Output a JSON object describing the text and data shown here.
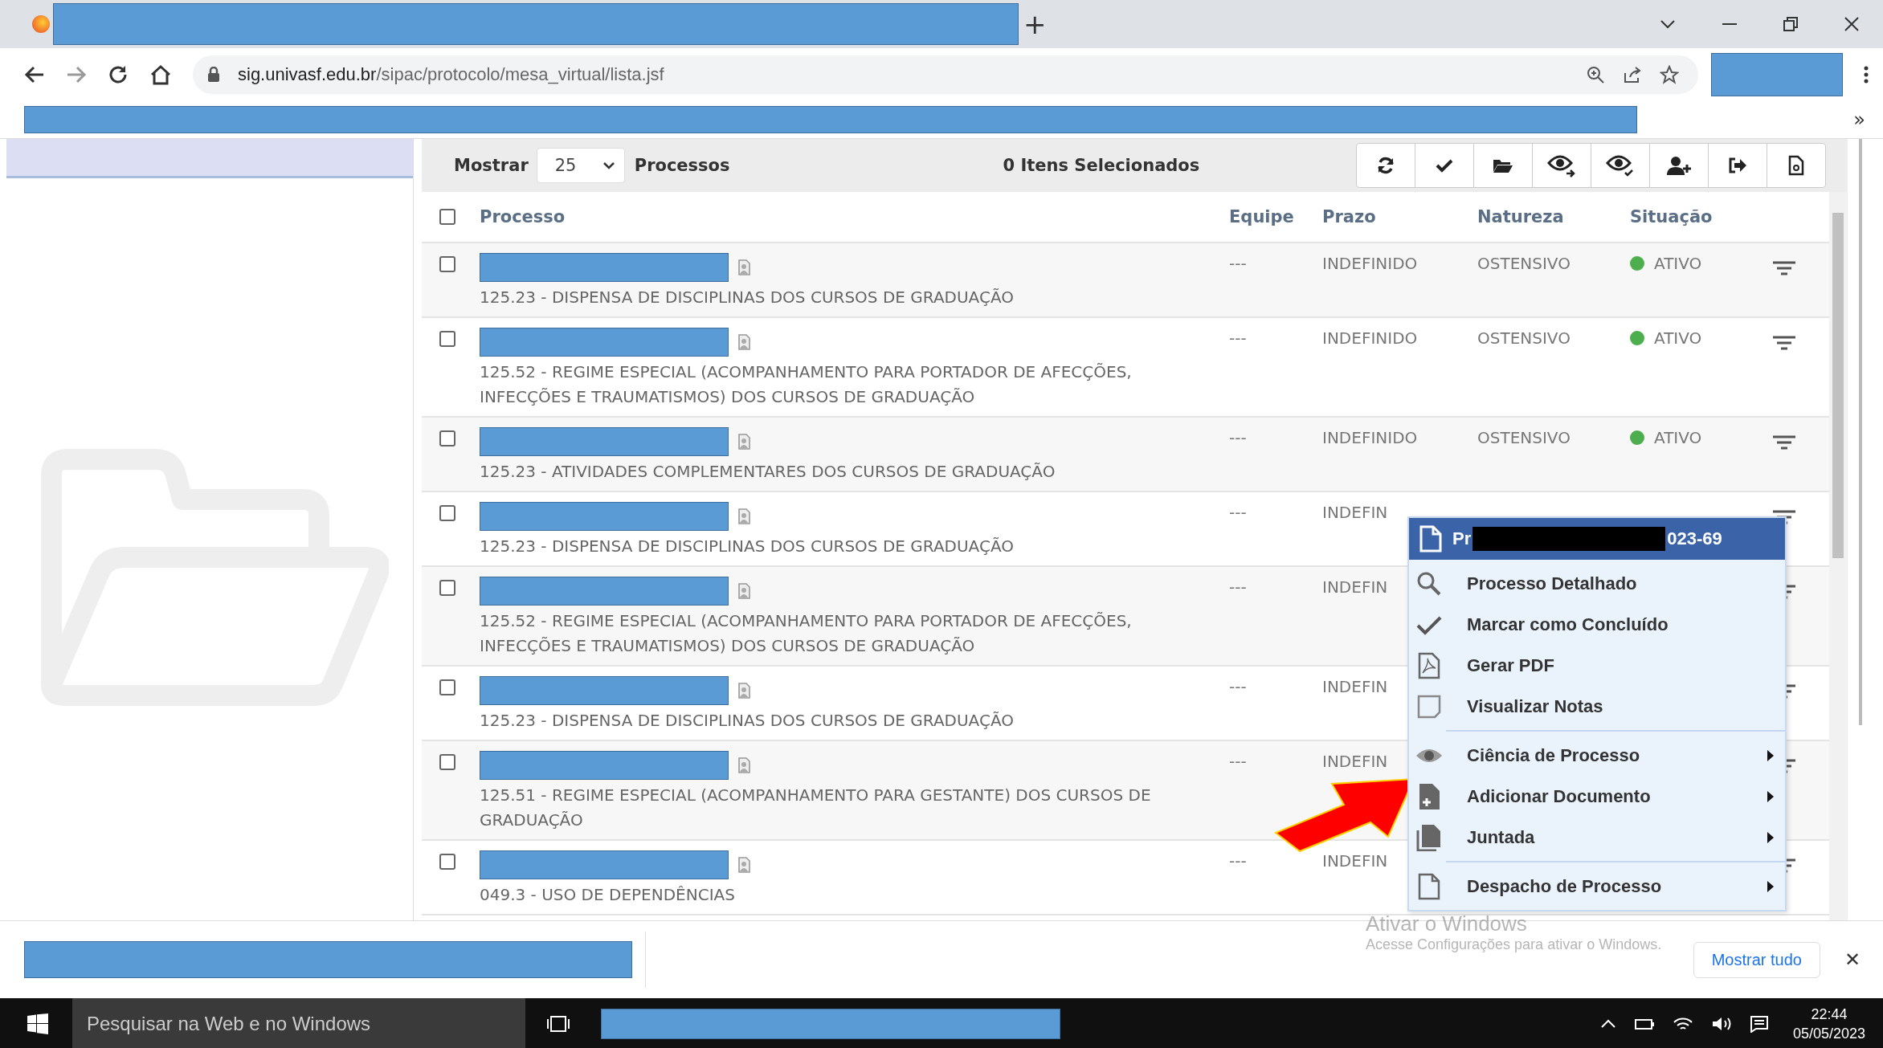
{
  "browser": {
    "new_tab": "+",
    "url": {
      "host": "sig.univasf.edu.br",
      "path": "/sipac/protocolo/mesa_virtual/lista.jsf"
    },
    "bookmarks_more": "»"
  },
  "toolbar": {
    "show_label": "Mostrar",
    "page_size": "25",
    "items_label": "Processos",
    "selected_count": "0 Itens Selecionados"
  },
  "table": {
    "select_all": {
      "checked": false
    },
    "columns": [
      "Processo",
      "Equipe",
      "Prazo",
      "Natureza",
      "Situação"
    ],
    "rows": [
      {
        "checked": false,
        "subject": "125.23 - DISPENSA DE DISCIPLINAS DOS CURSOS DE GRADUAÇÃO",
        "equipe": "---",
        "prazo": "INDEFINIDO",
        "natureza": "OSTENSIVO",
        "status": {
          "label": "ATIVO",
          "color": "#4cae4c"
        }
      },
      {
        "checked": false,
        "subject": "125.52 - REGIME ESPECIAL (ACOMPANHAMENTO PARA PORTADOR DE AFECÇÕES, INFECÇÕES E TRAUMATISMOS) DOS CURSOS DE GRADUAÇÃO",
        "equipe": "---",
        "prazo": "INDEFINIDO",
        "natureza": "OSTENSIVO",
        "status": {
          "label": "ATIVO",
          "color": "#4cae4c"
        }
      },
      {
        "checked": false,
        "subject": "125.23 - ATIVIDADES COMPLEMENTARES DOS CURSOS DE GRADUAÇÃO",
        "equipe": "---",
        "prazo": "INDEFINIDO",
        "natureza": "OSTENSIVO",
        "status": {
          "label": "ATIVO",
          "color": "#4cae4c"
        }
      },
      {
        "checked": false,
        "subject": "125.23 - DISPENSA DE DISCIPLINAS DOS CURSOS DE GRADUAÇÃO",
        "equipe": "---",
        "prazo": "INDEFIN"
      },
      {
        "checked": false,
        "subject": "125.52 - REGIME ESPECIAL (ACOMPANHAMENTO PARA PORTADOR DE AFECÇÕES, INFECÇÕES E TRAUMATISMOS) DOS CURSOS DE GRADUAÇÃO",
        "equipe": "---",
        "prazo": "INDEFIN"
      },
      {
        "checked": false,
        "subject": "125.23 - DISPENSA DE DISCIPLINAS DOS CURSOS DE GRADUAÇÃO",
        "equipe": "---",
        "prazo": "INDEFIN"
      },
      {
        "checked": false,
        "subject": "125.51 - REGIME ESPECIAL (ACOMPANHAMENTO PARA GESTANTE) DOS CURSOS DE GRADUAÇÃO",
        "equipe": "---",
        "prazo": "INDEFIN"
      },
      {
        "checked": false,
        "subject": "049.3 - USO DE DEPENDÊNCIAS",
        "equipe": "---",
        "prazo": "INDEFIN"
      }
    ]
  },
  "context_menu": {
    "title_start": "Pr",
    "title_end": "023-69",
    "groups": [
      [
        {
          "label": "Processo Detalhado",
          "submenu": false
        },
        {
          "label": "Marcar como Concluído",
          "submenu": false
        },
        {
          "label": "Gerar PDF",
          "submenu": false
        },
        {
          "label": "Visualizar Notas",
          "submenu": false
        }
      ],
      [
        {
          "label": "Ciência de Processo",
          "submenu": true
        },
        {
          "label": "Adicionar Documento",
          "submenu": true
        },
        {
          "label": "Juntada",
          "submenu": true
        }
      ],
      [
        {
          "label": "Despacho de Processo",
          "submenu": true
        }
      ]
    ]
  },
  "activation_notice": {
    "title": "Ativar o Windows",
    "text": "Acesse Configurações para ativar o Windows."
  },
  "download_bar": {
    "show_all": "Mostrar tudo",
    "close": "✕"
  },
  "taskbar": {
    "search_placeholder": "Pesquisar na Web e no Windows",
    "time": "22:44",
    "date": "05/05/2023"
  }
}
